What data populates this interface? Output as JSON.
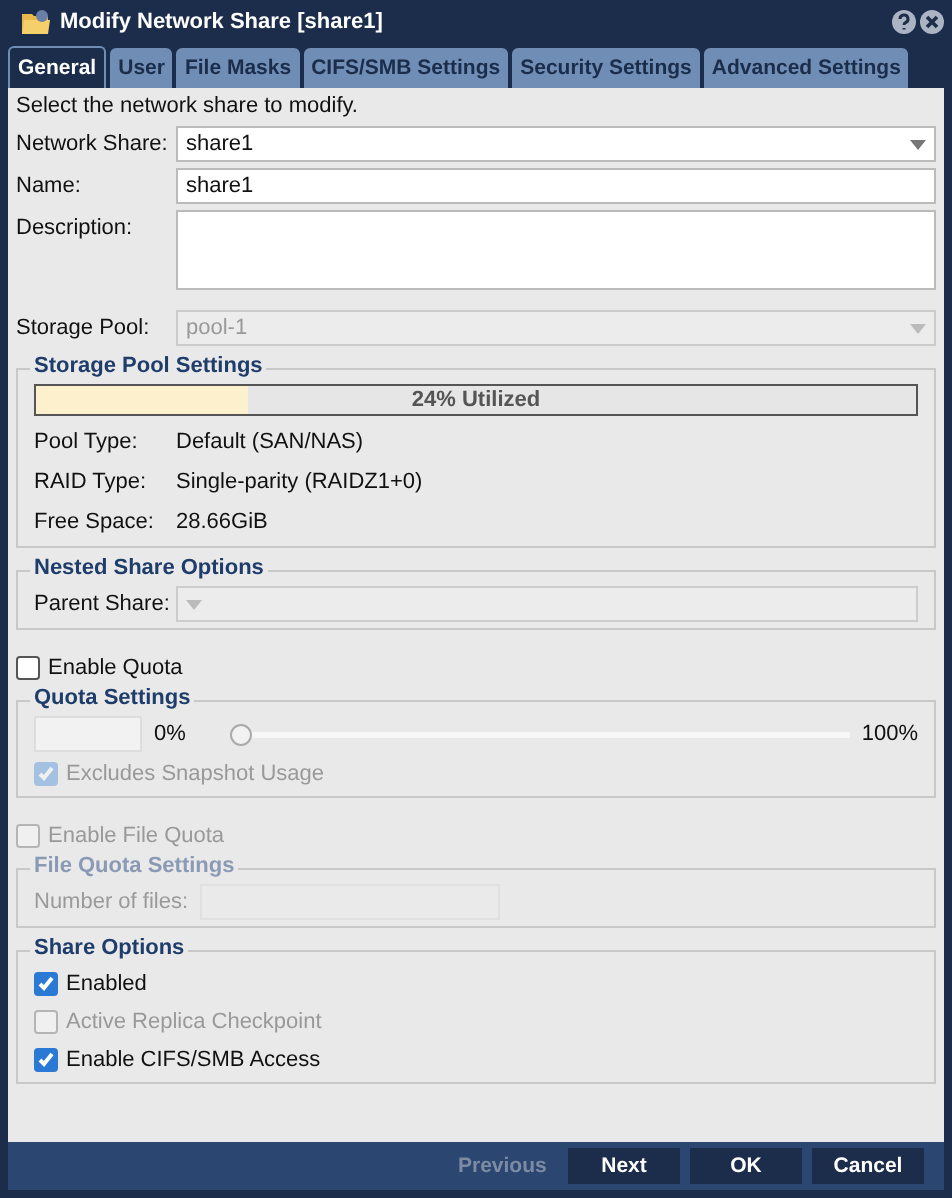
{
  "window": {
    "title": "Modify Network Share [share1]"
  },
  "tabs": [
    {
      "label": "General",
      "selected": true
    },
    {
      "label": "User",
      "selected": false
    },
    {
      "label": "File Masks",
      "selected": false
    },
    {
      "label": "CIFS/SMB Settings",
      "selected": false
    },
    {
      "label": "Security Settings",
      "selected": false
    },
    {
      "label": "Advanced Settings",
      "selected": false
    }
  ],
  "intro": "Select the network share to modify.",
  "fields": [
    {
      "kind": "select",
      "label": "Network Share:",
      "value": "share1",
      "disabled": false
    },
    {
      "kind": "text",
      "label": "Name:",
      "value": "share1",
      "disabled": false
    },
    {
      "kind": "textarea",
      "label": "Description:",
      "disabled": false
    },
    {
      "kind": "select",
      "label": "Storage Pool:",
      "value": "pool-1",
      "disabled": true
    }
  ],
  "storage_pool_settings": {
    "title": "Storage Pool Settings",
    "utilization": {
      "level": 0.24,
      "label": "24% Utilized"
    },
    "rows": [
      {
        "label": "Pool Type:",
        "value": "Default (SAN/NAS)"
      },
      {
        "label": "RAID Type:",
        "value": "Single-parity (RAIDZ1+0)"
      },
      {
        "label": "Free Space:",
        "value": "28.66GiB"
      }
    ]
  },
  "nested_share_options": {
    "title": "Nested Share Options",
    "parent_share": {
      "label": "Parent Share:",
      "disabled": true
    }
  },
  "enable_quota": {
    "label": "Enable Quota",
    "checked": false,
    "disabled": false
  },
  "quota_settings": {
    "title": "Quota Settings",
    "min_label": "0%",
    "max_label": "100%",
    "level": 0,
    "excludes_snapshot": {
      "label": "Excludes Snapshot Usage",
      "checked": true,
      "disabled": true
    }
  },
  "enable_file_quota": {
    "label": "Enable File Quota",
    "checked": false,
    "disabled": true
  },
  "file_quota_settings": {
    "title": "File Quota Settings",
    "number_of_files": {
      "label": "Number of files:"
    }
  },
  "share_options": {
    "title": "Share Options",
    "options": [
      {
        "label": "Enabled",
        "checked": true,
        "disabled": false
      },
      {
        "label": "Active Replica Checkpoint",
        "checked": false,
        "disabled": true
      },
      {
        "label": "Enable CIFS/SMB Access",
        "checked": true,
        "disabled": false
      }
    ]
  },
  "buttons": [
    {
      "label": "Previous",
      "disabled": true
    },
    {
      "label": "Next",
      "disabled": false
    },
    {
      "label": "OK",
      "disabled": false
    },
    {
      "label": "Cancel",
      "disabled": false
    }
  ]
}
